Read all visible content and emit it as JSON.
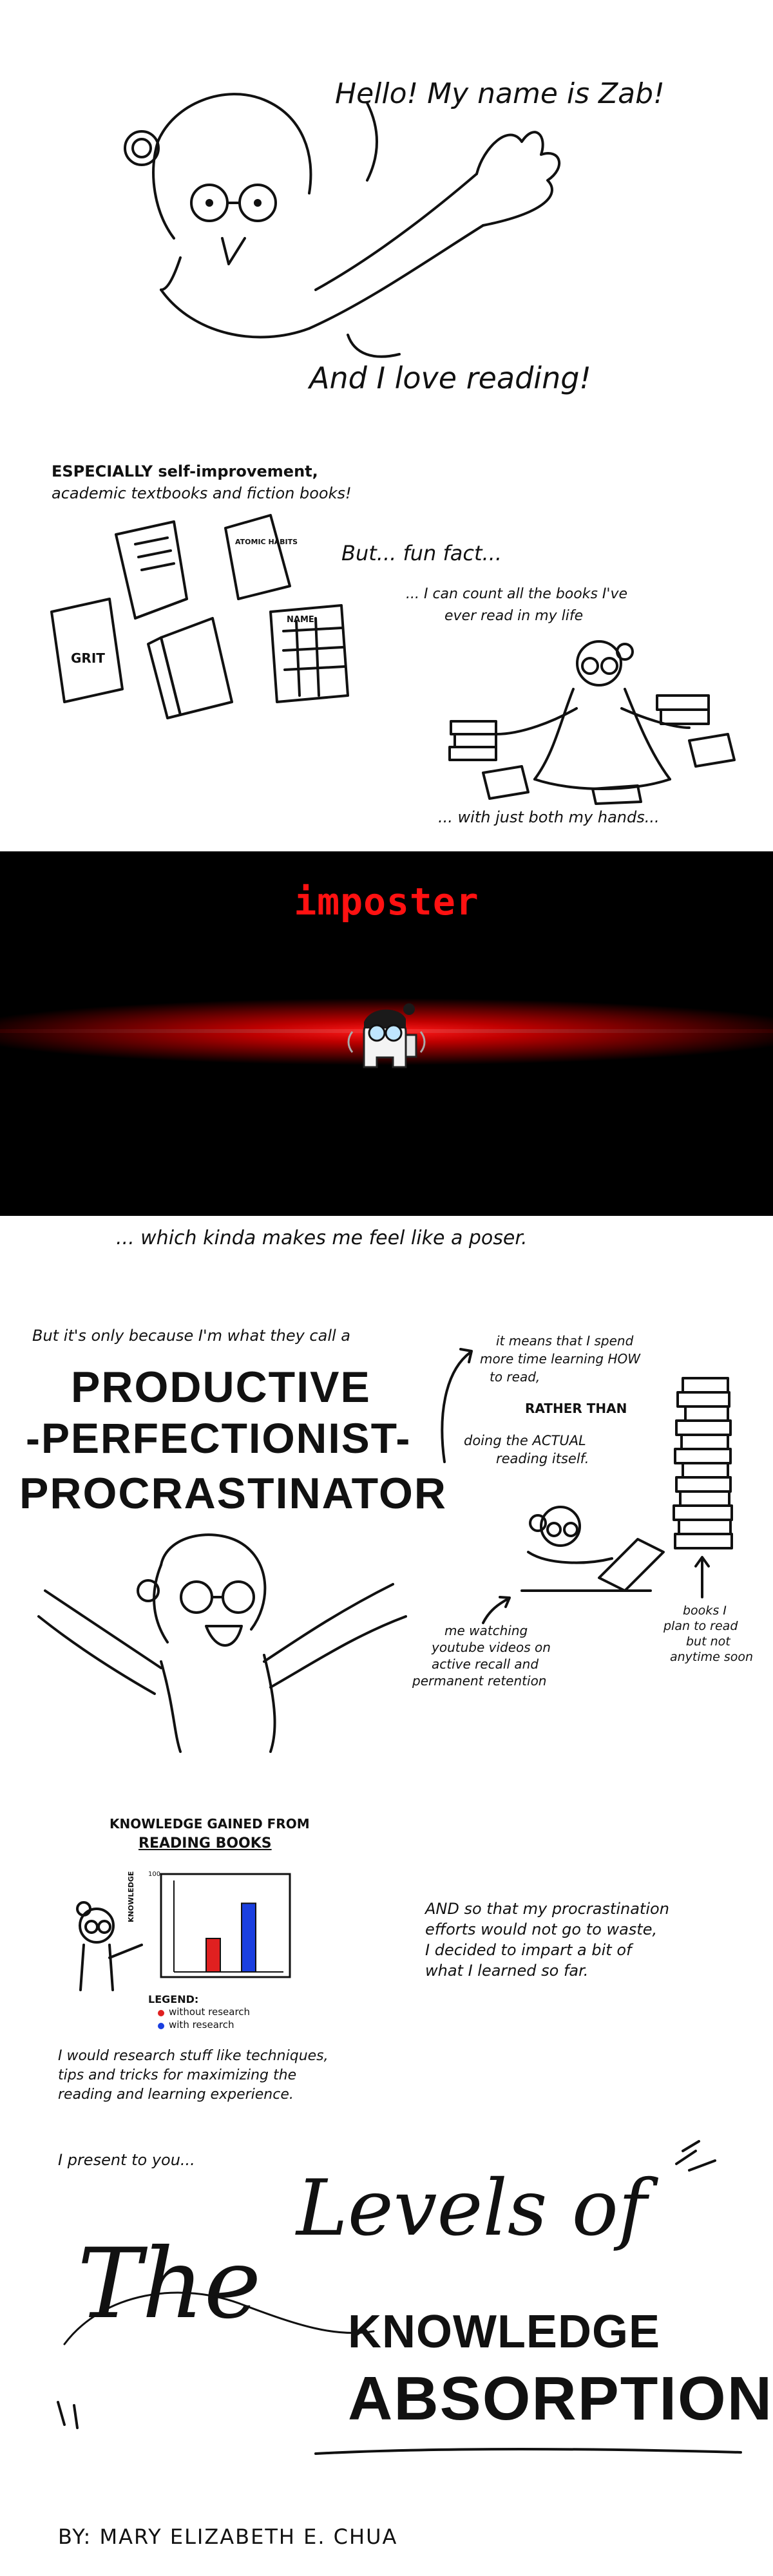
{
  "panel1": {
    "greeting": "Hello! My name is Zab!",
    "love": "And I love reading!"
  },
  "panel2": {
    "especially_1": "ESPECIALLY self-improvement,",
    "especially_2": "academic textbooks and fiction books!",
    "but": "But... fun fact...",
    "count_1": "... I can count all the books I've",
    "count_2": "ever read in my life",
    "hands": "... with just both my hands...",
    "book_grit": "GRIT",
    "book_atomic": "ATOMIC HABITS",
    "book_name": "NAME"
  },
  "panel3": {
    "imposter": "imposter",
    "poser": "... which kinda makes me feel like a poser."
  },
  "panel4": {
    "intro": "But it's only because I'm what they call a",
    "term_1": "PRODUCTIVE",
    "term_2": "-PERFECTIONIST-",
    "term_3": "PROCRASTINATOR",
    "means_1": "it means that I spend",
    "means_2": "more time learning HOW",
    "means_3": "to read,",
    "rather": "RATHER THAN",
    "doing_1": "doing the ACTUAL",
    "doing_2": "reading itself.",
    "watching_1": "me watching",
    "watching_2": "youtube videos on",
    "watching_3": "active recall and",
    "watching_4": "permanent retention",
    "books_1": "books I",
    "books_2": "plan to read",
    "books_3": "but not",
    "books_4": "anytime soon"
  },
  "panel5": {
    "chart_title_1": "KNOWLEDGE GAINED FROM",
    "chart_title_2": "READING BOOKS",
    "ylabel": "KNOWLEDGE",
    "ytick": "100",
    "legend_title": "LEGEND:",
    "legend_red": "without research",
    "legend_blue": "with research",
    "research_1": "I would research stuff like techniques,",
    "research_2": "tips and tricks for maximizing the",
    "research_3": "reading and learning experience.",
    "and_1": "AND so that my procrastination",
    "and_2": "efforts would not go to waste,",
    "and_3": "I decided to impart a bit of",
    "and_4": "what I learned so far.",
    "red_color": "#e02020",
    "blue_color": "#1a3fe0"
  },
  "chart_data": {
    "type": "bar",
    "title": "KNOWLEDGE GAINED FROM READING BOOKS",
    "ylabel": "KNOWLEDGE",
    "ylim": [
      0,
      100
    ],
    "categories": [
      ""
    ],
    "series": [
      {
        "name": "without research",
        "values": [
          40
        ]
      },
      {
        "name": "with research",
        "values": [
          82
        ]
      }
    ],
    "legend": "bottom-left"
  },
  "panel6": {
    "present": "I present to you...",
    "the": "The",
    "levels": "Levels of",
    "knowledge": "KNOWLEDGE",
    "absorption": "ABSORPTION",
    "byline": "BY: MARY ELIZABETH E. CHUA"
  }
}
